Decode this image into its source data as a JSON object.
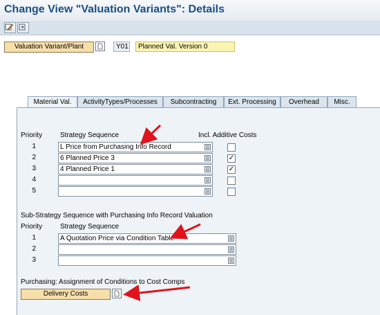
{
  "window": {
    "title": "Change View \"Valuation Variants\": Details"
  },
  "toolbar": {
    "buttons": [
      "display-change-icon",
      "other-view-icon"
    ]
  },
  "header": {
    "valuation_variant_label": "Valuation Variant/Plant",
    "variant_code": "Y01",
    "variant_description": "Planned Val. Version 0"
  },
  "tabs": [
    {
      "label": "Material Val.",
      "active": true
    },
    {
      "label": "ActivityTypes/Processes",
      "active": false
    },
    {
      "label": "Subcontracting",
      "active": false
    },
    {
      "label": "Ext. Processing",
      "active": false
    },
    {
      "label": "Overhead",
      "active": false
    },
    {
      "label": "Misc.",
      "active": false
    }
  ],
  "strategy": {
    "col_priority": "Priority",
    "col_sequence": "Strategy Sequence",
    "col_additive": "Incl. Additive Costs",
    "rows": [
      {
        "priority": "1",
        "value": "L Price from Purchasing Info Record",
        "additive": false
      },
      {
        "priority": "2",
        "value": "6 Planned Price 3",
        "additive": true
      },
      {
        "priority": "3",
        "value": "4 Planned Price 1",
        "additive": true
      },
      {
        "priority": "4",
        "value": "",
        "additive": false
      },
      {
        "priority": "5",
        "value": "",
        "additive": false
      }
    ]
  },
  "sub_strategy": {
    "section_title": "Sub-Strategy Sequence with Purchasing Info Record Valuation",
    "col_priority": "Priority",
    "col_sequence": "Strategy Sequence",
    "rows": [
      {
        "priority": "1",
        "value": "A Quotation Price via Condition Table"
      },
      {
        "priority": "2",
        "value": ""
      },
      {
        "priority": "3",
        "value": ""
      }
    ]
  },
  "purchasing": {
    "section_title": "Purchasing: Assignment of Conditions to Cost Comps",
    "delivery_costs_label": "Delivery Costs"
  },
  "colors": {
    "title": "#1a4f86",
    "panel_bg": "#eef3f7",
    "button_bg": "#f7dfaa",
    "desc_bg": "#fbf5b4",
    "arrow": "#e0141c"
  }
}
